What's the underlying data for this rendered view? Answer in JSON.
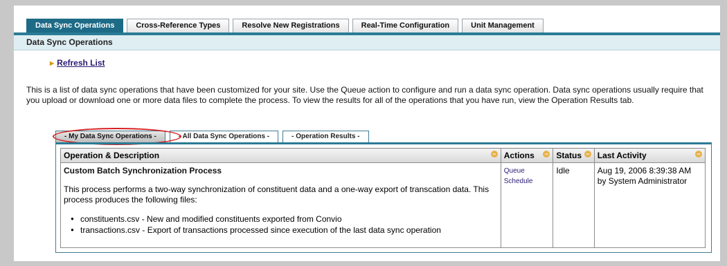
{
  "tabs": [
    {
      "label": "Data Sync Operations",
      "active": true
    },
    {
      "label": "Cross-Reference Types",
      "active": false
    },
    {
      "label": "Resolve New Registrations",
      "active": false
    },
    {
      "label": "Real-Time Configuration",
      "active": false
    },
    {
      "label": "Unit Management",
      "active": false
    }
  ],
  "section_title": "Data Sync Operations",
  "refresh_label": "Refresh List",
  "intro_text": "This is a list of data sync operations that have been customized for your site. Use the Queue action to configure and run a data sync operation. Data sync operations usually require that you upload or download one or more data files to complete the process. To view the results for all of the operations that you have run, view the Operation Results tab.",
  "subtabs": [
    {
      "label": "- My Data Sync Operations -",
      "active": true
    },
    {
      "label": "- All Data Sync Operations -",
      "active": false
    },
    {
      "label": "- Operation Results -",
      "active": false
    }
  ],
  "table": {
    "headers": [
      "Operation & Description",
      "Actions",
      "Status",
      "Last Activity"
    ],
    "row": {
      "title": "Custom Batch Synchronization Process",
      "description": "This process performs a two-way synchronization of constituent data and a one-way export of transcation data. This process produces the following files:",
      "files": [
        "constituents.csv - New and modified constituents exported from Convio",
        "transactions.csv - Export of transactions processed since execution of the last data sync operation"
      ],
      "actions": [
        "Queue",
        "Schedule"
      ],
      "status": "Idle",
      "activity_date": "Aug 19, 2006 8:39:38 AM",
      "activity_by": "by System Administrator"
    }
  }
}
